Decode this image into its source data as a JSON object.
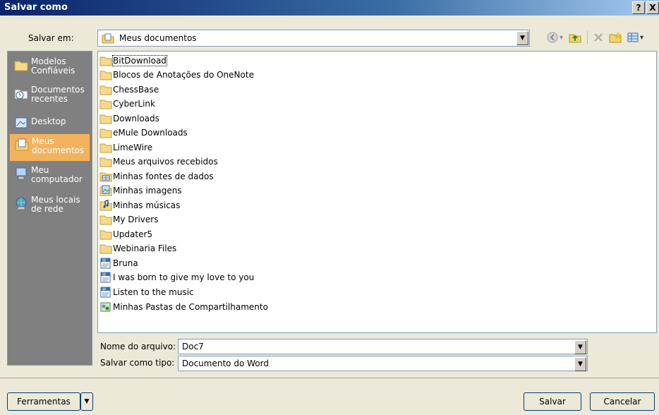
{
  "window": {
    "title": "Salvar como",
    "help_glyph": "?",
    "close_glyph": "X"
  },
  "location": {
    "label": "Salvar em:",
    "value": "Meus documentos"
  },
  "toolbar": {
    "back_icon": "back-icon",
    "up_icon": "up-folder-icon",
    "delete_icon": "delete-icon",
    "new_folder_icon": "new-folder-icon",
    "views_icon": "views-icon"
  },
  "places": [
    {
      "label": "Modelos\nConfiáveis",
      "icon": "folder-icon"
    },
    {
      "label": "Documentos\nrecentes",
      "icon": "recent-docs-icon"
    },
    {
      "label": "Desktop",
      "icon": "desktop-icon"
    },
    {
      "label": "Meus\ndocumentos",
      "icon": "my-documents-icon",
      "active": true
    },
    {
      "label": "Meu\ncomputador",
      "icon": "computer-icon"
    },
    {
      "label": "Meus locais\nde rede",
      "icon": "network-icon"
    }
  ],
  "files": [
    {
      "name": "BitDownload",
      "type": "folder"
    },
    {
      "name": "Blocos de Anotações do OneNote",
      "type": "folder"
    },
    {
      "name": "ChessBase",
      "type": "folder"
    },
    {
      "name": "CyberLink",
      "type": "folder"
    },
    {
      "name": "Downloads",
      "type": "folder"
    },
    {
      "name": "eMule Downloads",
      "type": "folder"
    },
    {
      "name": "LimeWire",
      "type": "folder"
    },
    {
      "name": "Meus arquivos recebidos",
      "type": "folder"
    },
    {
      "name": "Minhas fontes de dados",
      "type": "datasource"
    },
    {
      "name": "Minhas imagens",
      "type": "pictures"
    },
    {
      "name": "Minhas músicas",
      "type": "music"
    },
    {
      "name": "My Drivers",
      "type": "folder"
    },
    {
      "name": "Updater5",
      "type": "folder"
    },
    {
      "name": "Webinaria Files",
      "type": "folder"
    },
    {
      "name": "Bruna",
      "type": "word"
    },
    {
      "name": "I was born to give my love to you",
      "type": "word"
    },
    {
      "name": "Listen to the music",
      "type": "word"
    },
    {
      "name": "Minhas Pastas de Compartilhamento",
      "type": "shared"
    }
  ],
  "filename": {
    "label": "Nome do arquivo:",
    "value": "Doc7"
  },
  "filetype": {
    "label": "Salvar como tipo:",
    "value": "Documento do Word"
  },
  "buttons": {
    "tools": "Ferramentas",
    "save": "Salvar",
    "cancel": "Cancelar"
  }
}
